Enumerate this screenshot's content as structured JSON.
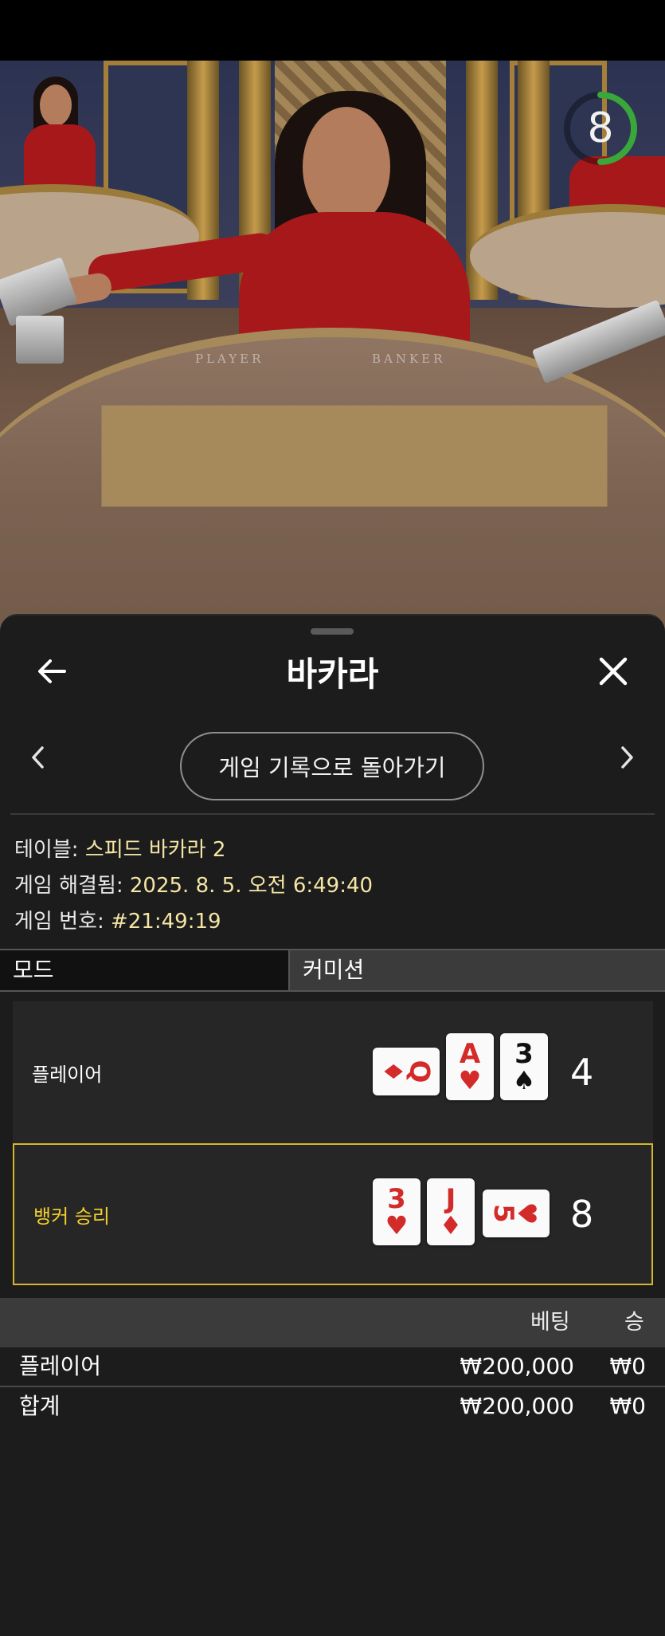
{
  "video": {
    "timer_value": "8",
    "timer_color": "#3aa73a",
    "table_labels": [
      "PLAYER",
      "BANKER"
    ]
  },
  "sheet": {
    "title": "바카라",
    "back_icon": "arrow-left-icon",
    "close_icon": "close-icon",
    "prev_icon": "chevron-left-icon",
    "next_icon": "chevron-right-icon",
    "back_to_history_label": "게임 기록으로 돌아가기"
  },
  "info": {
    "table_label": "테이블: ",
    "table_value": "스피드 바카라 2",
    "resolved_label": "게임 해결됨: ",
    "resolved_value": "2025. 8. 5. 오전 6:49:40",
    "game_no_label": "게임 번호: ",
    "game_no_value": "#21:49:19"
  },
  "tabs": {
    "mode": "모드",
    "commission": "커미션"
  },
  "hands": {
    "player": {
      "label": "플레이어",
      "score": "4",
      "cards": [
        {
          "rank": "Q",
          "suit": "♦",
          "color": "red",
          "orientation": "horizontal"
        },
        {
          "rank": "A",
          "suit": "♥",
          "color": "red",
          "orientation": "vertical"
        },
        {
          "rank": "3",
          "suit": "♠",
          "color": "black",
          "orientation": "vertical"
        }
      ]
    },
    "banker": {
      "label": "뱅커 승리",
      "label_color": "#f2cf2c",
      "score": "8",
      "cards": [
        {
          "rank": "3",
          "suit": "♥",
          "color": "red",
          "orientation": "vertical"
        },
        {
          "rank": "J",
          "suit": "♦",
          "color": "red",
          "orientation": "vertical"
        },
        {
          "rank": "5",
          "suit": "♥",
          "color": "red",
          "orientation": "horizontal"
        }
      ]
    }
  },
  "bets": {
    "header_bet": "베팅",
    "header_win": "승",
    "rows": [
      {
        "name": "플레이어",
        "bet": "₩200,000",
        "win": "₩0"
      }
    ],
    "total": {
      "name": "합계",
      "bet": "₩200,000",
      "win": "₩0"
    }
  }
}
